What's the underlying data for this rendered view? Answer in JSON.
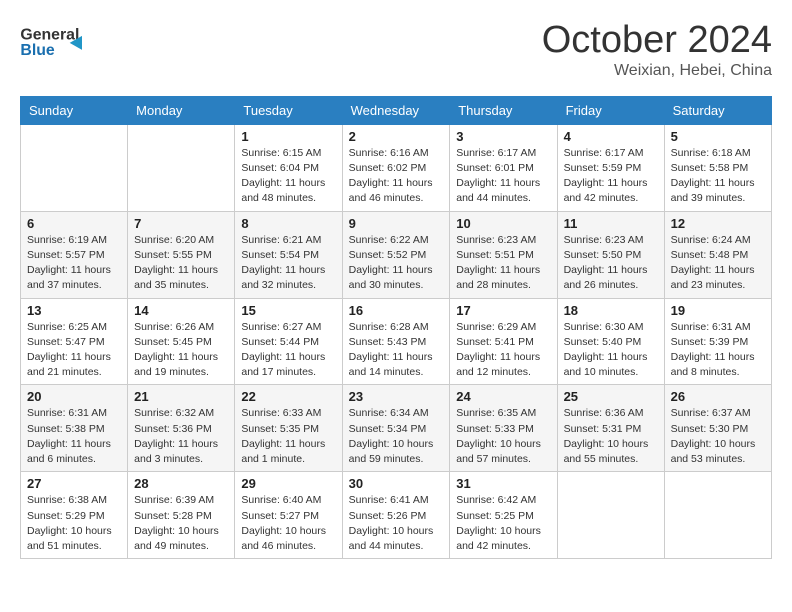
{
  "header": {
    "logo_general": "General",
    "logo_blue": "Blue",
    "month": "October 2024",
    "location": "Weixian, Hebei, China"
  },
  "days_of_week": [
    "Sunday",
    "Monday",
    "Tuesday",
    "Wednesday",
    "Thursday",
    "Friday",
    "Saturday"
  ],
  "weeks": [
    [
      {
        "num": "",
        "info": ""
      },
      {
        "num": "",
        "info": ""
      },
      {
        "num": "1",
        "info": "Sunrise: 6:15 AM\nSunset: 6:04 PM\nDaylight: 11 hours and 48 minutes."
      },
      {
        "num": "2",
        "info": "Sunrise: 6:16 AM\nSunset: 6:02 PM\nDaylight: 11 hours and 46 minutes."
      },
      {
        "num": "3",
        "info": "Sunrise: 6:17 AM\nSunset: 6:01 PM\nDaylight: 11 hours and 44 minutes."
      },
      {
        "num": "4",
        "info": "Sunrise: 6:17 AM\nSunset: 5:59 PM\nDaylight: 11 hours and 42 minutes."
      },
      {
        "num": "5",
        "info": "Sunrise: 6:18 AM\nSunset: 5:58 PM\nDaylight: 11 hours and 39 minutes."
      }
    ],
    [
      {
        "num": "6",
        "info": "Sunrise: 6:19 AM\nSunset: 5:57 PM\nDaylight: 11 hours and 37 minutes."
      },
      {
        "num": "7",
        "info": "Sunrise: 6:20 AM\nSunset: 5:55 PM\nDaylight: 11 hours and 35 minutes."
      },
      {
        "num": "8",
        "info": "Sunrise: 6:21 AM\nSunset: 5:54 PM\nDaylight: 11 hours and 32 minutes."
      },
      {
        "num": "9",
        "info": "Sunrise: 6:22 AM\nSunset: 5:52 PM\nDaylight: 11 hours and 30 minutes."
      },
      {
        "num": "10",
        "info": "Sunrise: 6:23 AM\nSunset: 5:51 PM\nDaylight: 11 hours and 28 minutes."
      },
      {
        "num": "11",
        "info": "Sunrise: 6:23 AM\nSunset: 5:50 PM\nDaylight: 11 hours and 26 minutes."
      },
      {
        "num": "12",
        "info": "Sunrise: 6:24 AM\nSunset: 5:48 PM\nDaylight: 11 hours and 23 minutes."
      }
    ],
    [
      {
        "num": "13",
        "info": "Sunrise: 6:25 AM\nSunset: 5:47 PM\nDaylight: 11 hours and 21 minutes."
      },
      {
        "num": "14",
        "info": "Sunrise: 6:26 AM\nSunset: 5:45 PM\nDaylight: 11 hours and 19 minutes."
      },
      {
        "num": "15",
        "info": "Sunrise: 6:27 AM\nSunset: 5:44 PM\nDaylight: 11 hours and 17 minutes."
      },
      {
        "num": "16",
        "info": "Sunrise: 6:28 AM\nSunset: 5:43 PM\nDaylight: 11 hours and 14 minutes."
      },
      {
        "num": "17",
        "info": "Sunrise: 6:29 AM\nSunset: 5:41 PM\nDaylight: 11 hours and 12 minutes."
      },
      {
        "num": "18",
        "info": "Sunrise: 6:30 AM\nSunset: 5:40 PM\nDaylight: 11 hours and 10 minutes."
      },
      {
        "num": "19",
        "info": "Sunrise: 6:31 AM\nSunset: 5:39 PM\nDaylight: 11 hours and 8 minutes."
      }
    ],
    [
      {
        "num": "20",
        "info": "Sunrise: 6:31 AM\nSunset: 5:38 PM\nDaylight: 11 hours and 6 minutes."
      },
      {
        "num": "21",
        "info": "Sunrise: 6:32 AM\nSunset: 5:36 PM\nDaylight: 11 hours and 3 minutes."
      },
      {
        "num": "22",
        "info": "Sunrise: 6:33 AM\nSunset: 5:35 PM\nDaylight: 11 hours and 1 minute."
      },
      {
        "num": "23",
        "info": "Sunrise: 6:34 AM\nSunset: 5:34 PM\nDaylight: 10 hours and 59 minutes."
      },
      {
        "num": "24",
        "info": "Sunrise: 6:35 AM\nSunset: 5:33 PM\nDaylight: 10 hours and 57 minutes."
      },
      {
        "num": "25",
        "info": "Sunrise: 6:36 AM\nSunset: 5:31 PM\nDaylight: 10 hours and 55 minutes."
      },
      {
        "num": "26",
        "info": "Sunrise: 6:37 AM\nSunset: 5:30 PM\nDaylight: 10 hours and 53 minutes."
      }
    ],
    [
      {
        "num": "27",
        "info": "Sunrise: 6:38 AM\nSunset: 5:29 PM\nDaylight: 10 hours and 51 minutes."
      },
      {
        "num": "28",
        "info": "Sunrise: 6:39 AM\nSunset: 5:28 PM\nDaylight: 10 hours and 49 minutes."
      },
      {
        "num": "29",
        "info": "Sunrise: 6:40 AM\nSunset: 5:27 PM\nDaylight: 10 hours and 46 minutes."
      },
      {
        "num": "30",
        "info": "Sunrise: 6:41 AM\nSunset: 5:26 PM\nDaylight: 10 hours and 44 minutes."
      },
      {
        "num": "31",
        "info": "Sunrise: 6:42 AM\nSunset: 5:25 PM\nDaylight: 10 hours and 42 minutes."
      },
      {
        "num": "",
        "info": ""
      },
      {
        "num": "",
        "info": ""
      }
    ]
  ]
}
